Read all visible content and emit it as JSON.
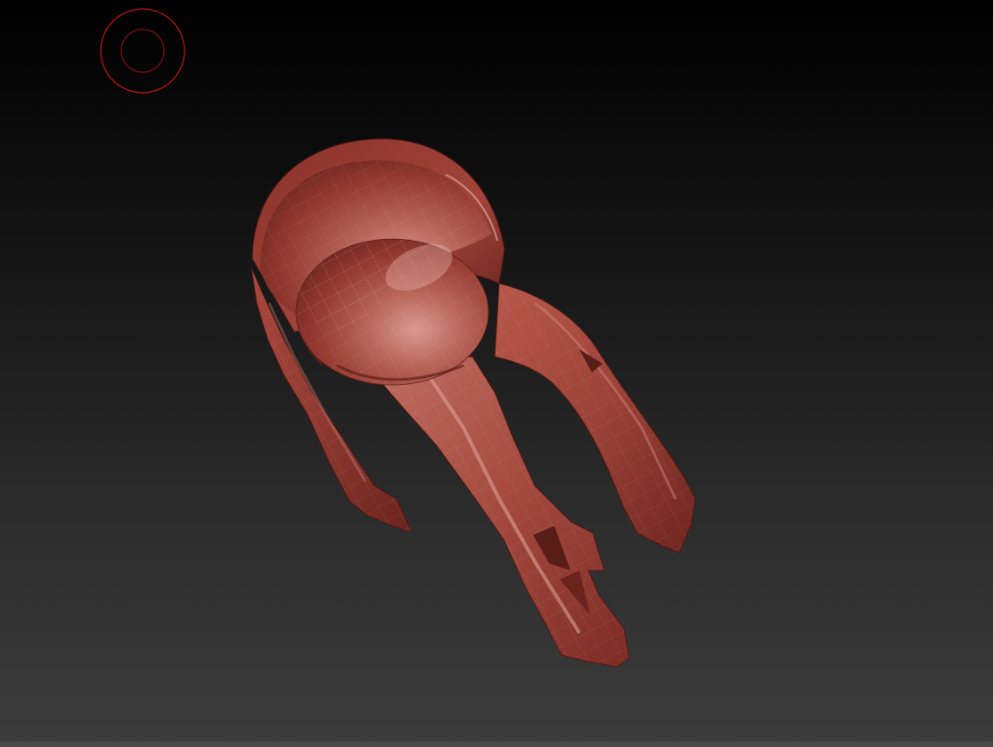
{
  "viewport": {
    "background_top": "#000000",
    "background_bottom": "#3c3c3c"
  },
  "brush_cursor": {
    "color": "#c81414",
    "icon": "brush-circle-icon"
  },
  "model": {
    "material_color": "#9a3a30",
    "highlight_color": "#d08a80",
    "shadow_color": "#5a1e18"
  }
}
